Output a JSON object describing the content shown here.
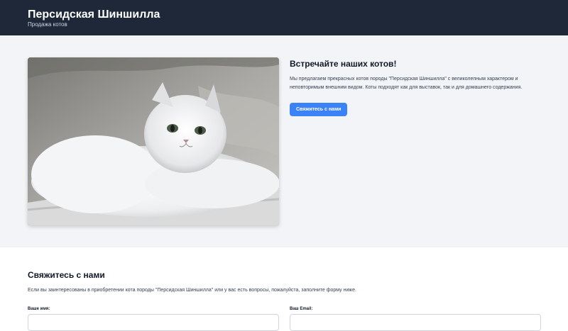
{
  "header": {
    "title": "Персидская Шиншилла",
    "subtitle": "Продажа котов"
  },
  "hero": {
    "image_alt": "white-persian-chinchilla-cat-photo",
    "heading": "Встречайте наших котов!",
    "body": "Мы предлагаем прекрасных котов породы \"Персидская Шиншилла\" с великолепным характером и неповторимым внешним видом. Коты подходят как для выставок, так и для домашнего содержания.",
    "cta_label": "Свяжитесь с нами"
  },
  "contact": {
    "heading": "Свяжитесь с нами",
    "description": "Если вы заинтересованы в приобретении кота породы \"Персидская Шиншилла\" или у вас есть вопросы, пожалуйста, заполните форму ниже.",
    "name_label": "Ваше имя:",
    "name_value": "",
    "email_label": "Ваш Email:",
    "email_value": ""
  },
  "colors": {
    "header_bg": "#1e2838",
    "hero_bg": "#f2f4f7",
    "accent": "#3b82f6"
  }
}
